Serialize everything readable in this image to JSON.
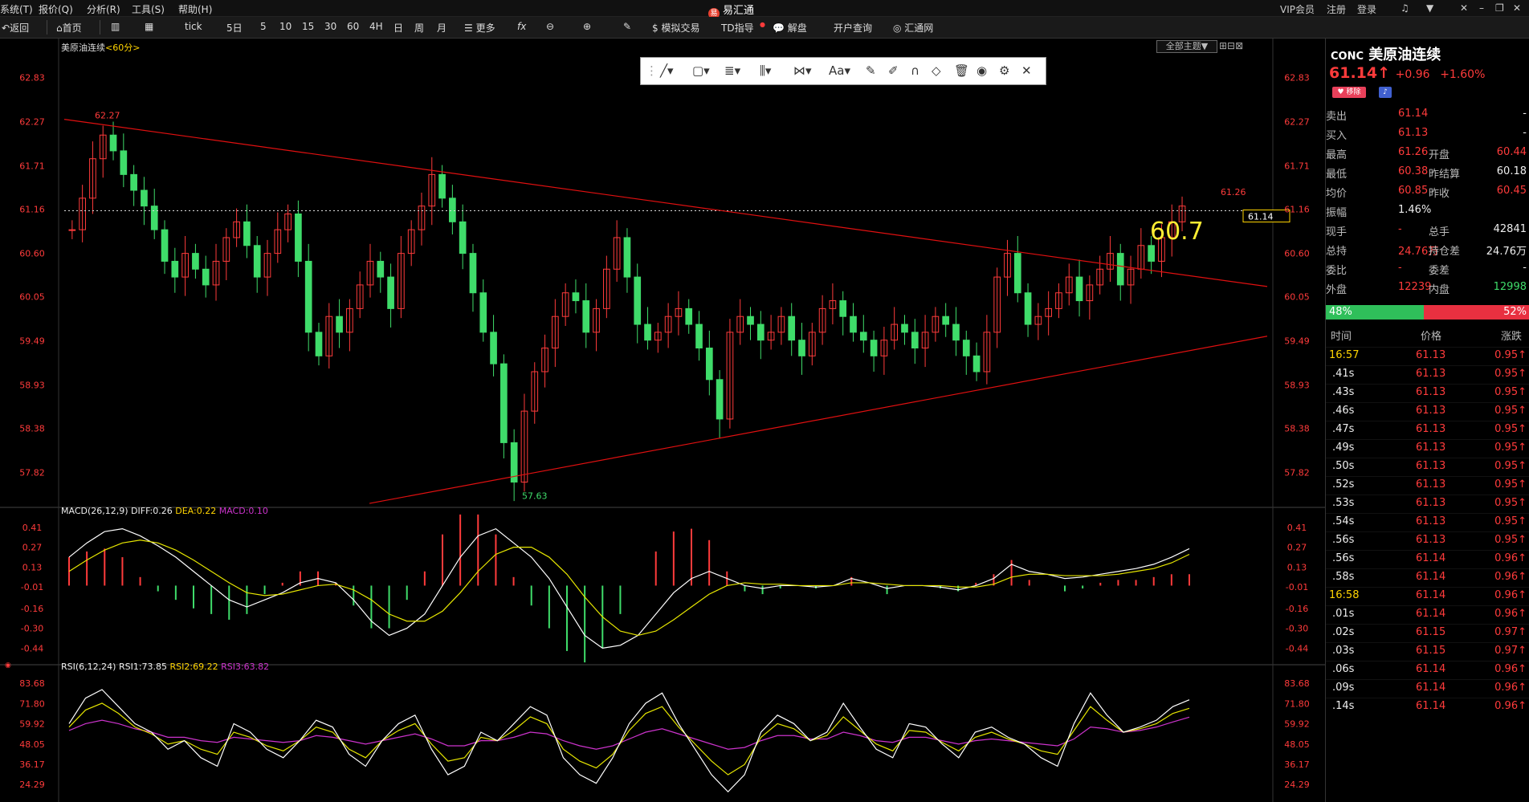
{
  "menu": {
    "items": [
      "系统(T)",
      "报价(Q)",
      "分析(R)",
      "工具(S)",
      "帮助(H)"
    ],
    "app_title": "易汇通",
    "right_items": [
      "VIP会员",
      "注册",
      "登录"
    ]
  },
  "toolbar": {
    "back": "返回",
    "home": "首页",
    "tick": "tick",
    "periods": [
      "5日",
      "5",
      "10",
      "15",
      "30",
      "60",
      "4H",
      "日",
      "周",
      "月"
    ],
    "more": "更多",
    "fx": "fx",
    "sim_trade": "模拟交易",
    "td_guide": "TD指导",
    "analysis": "解盘",
    "account_query": "开户查询",
    "huitong": "汇通网"
  },
  "chart": {
    "symbol_label": "美原油连续",
    "period_label": "<60分>",
    "theme_button": "全部主题",
    "price_ticks": [
      "62.83",
      "62.27",
      "61.71",
      "61.16",
      "60.60",
      "60.05",
      "59.49",
      "58.93",
      "58.38",
      "57.82"
    ],
    "current_price_tag": "61.14",
    "annot_high": "62.27",
    "annot_low": "57.63",
    "annot_recent_high": "61.26",
    "annot_big": "60.7",
    "macd": {
      "title": "MACD(26,12,9)",
      "diff": "DIFF:0.26",
      "dea": "DEA:0.22",
      "macd": "MACD:0.10",
      "ticks": [
        "0.41",
        "0.27",
        "0.13",
        "-0.01",
        "-0.16",
        "-0.30",
        "-0.44"
      ]
    },
    "rsi": {
      "title": "RSI(6,12,24)",
      "rsi1": "RSI1:73.85",
      "rsi2": "RSI2:69.22",
      "rsi3": "RSI3:63.82",
      "ticks": [
        "83.68",
        "71.80",
        "59.92",
        "48.05",
        "36.17",
        "24.29"
      ]
    },
    "colors": {
      "up": "#ff3b3b",
      "down": "#3fdc6a",
      "trend": "#e01010",
      "diff": "#ffffff",
      "dea": "#e6e600",
      "macd": "#cc33cc"
    }
  },
  "chart_data": {
    "type": "candlestick",
    "timeframe": "60分",
    "ylim": [
      57.4,
      63.1
    ],
    "price_close_series": [
      60.9,
      61.3,
      61.8,
      62.1,
      61.9,
      61.6,
      61.4,
      61.2,
      60.9,
      60.5,
      60.3,
      60.6,
      60.4,
      60.2,
      60.5,
      60.8,
      61.0,
      60.7,
      60.3,
      60.6,
      60.9,
      61.1,
      60.5,
      59.6,
      59.3,
      59.8,
      59.6,
      59.9,
      60.2,
      60.5,
      60.3,
      59.9,
      60.6,
      60.9,
      61.2,
      61.6,
      61.3,
      61.0,
      60.6,
      60.1,
      59.6,
      59.2,
      58.2,
      57.7,
      58.6,
      59.1,
      59.4,
      59.8,
      60.1,
      60.0,
      59.6,
      59.9,
      60.4,
      60.8,
      60.3,
      59.7,
      59.5,
      59.6,
      59.8,
      59.9,
      59.7,
      59.4,
      59.0,
      58.5,
      59.6,
      59.8,
      59.7,
      59.5,
      59.6,
      59.8,
      59.5,
      59.3,
      59.6,
      59.9,
      60.0,
      59.8,
      59.6,
      59.5,
      59.3,
      59.5,
      59.7,
      59.6,
      59.4,
      59.6,
      59.8,
      59.7,
      59.5,
      59.3,
      59.1,
      59.6,
      60.3,
      60.6,
      60.1,
      59.7,
      59.8,
      59.9,
      60.1,
      60.3,
      60.0,
      60.2,
      60.4,
      60.6,
      60.2,
      60.4,
      60.7,
      60.5,
      60.8,
      61.0,
      61.2
    ],
    "annotations": [
      "62.27",
      "57.63",
      "61.26",
      "60.7"
    ],
    "macd_series": {
      "diff": [
        0.2,
        0.3,
        0.38,
        0.4,
        0.35,
        0.28,
        0.2,
        0.1,
        0.0,
        -0.1,
        -0.15,
        -0.1,
        -0.05,
        0.02,
        0.05,
        0.02,
        -0.1,
        -0.25,
        -0.35,
        -0.3,
        -0.2,
        0.0,
        0.2,
        0.35,
        0.4,
        0.3,
        0.2,
        0.05,
        -0.15,
        -0.35,
        -0.44,
        -0.42,
        -0.35,
        -0.2,
        -0.05,
        0.05,
        0.1,
        0.05,
        0.0,
        -0.02,
        0.0,
        0.0,
        -0.01,
        0.0,
        0.05,
        0.02,
        -0.02,
        0.0,
        0.0,
        -0.01,
        -0.03,
        0.0,
        0.05,
        0.15,
        0.1,
        0.08,
        0.05,
        0.06,
        0.08,
        0.1,
        0.12,
        0.15,
        0.2,
        0.26
      ],
      "dea": [
        0.1,
        0.18,
        0.25,
        0.3,
        0.32,
        0.3,
        0.25,
        0.18,
        0.1,
        0.02,
        -0.05,
        -0.07,
        -0.06,
        -0.03,
        0.0,
        0.01,
        -0.03,
        -0.1,
        -0.2,
        -0.25,
        -0.25,
        -0.18,
        -0.05,
        0.1,
        0.22,
        0.27,
        0.27,
        0.2,
        0.08,
        -0.08,
        -0.22,
        -0.32,
        -0.35,
        -0.32,
        -0.24,
        -0.15,
        -0.06,
        0.0,
        0.02,
        0.01,
        0.01,
        0.0,
        0.0,
        0.0,
        0.02,
        0.02,
        0.01,
        0.0,
        0.0,
        0.0,
        -0.01,
        -0.01,
        0.01,
        0.06,
        0.08,
        0.08,
        0.07,
        0.07,
        0.07,
        0.08,
        0.1,
        0.12,
        0.16,
        0.22
      ]
    },
    "rsi_series": {
      "rsi1": [
        60,
        75,
        80,
        70,
        60,
        55,
        45,
        50,
        40,
        35,
        60,
        55,
        45,
        40,
        50,
        62,
        58,
        42,
        35,
        50,
        60,
        65,
        45,
        30,
        35,
        55,
        50,
        60,
        70,
        65,
        40,
        30,
        25,
        40,
        60,
        72,
        78,
        60,
        45,
        30,
        20,
        30,
        55,
        65,
        60,
        50,
        55,
        72,
        58,
        45,
        40,
        60,
        58,
        48,
        40,
        55,
        58,
        52,
        48,
        40,
        35,
        60,
        78,
        65,
        55,
        58,
        62,
        70,
        74
      ],
      "rsi2": [
        58,
        68,
        72,
        66,
        58,
        54,
        48,
        50,
        45,
        42,
        55,
        52,
        47,
        44,
        50,
        58,
        55,
        45,
        40,
        50,
        56,
        60,
        48,
        38,
        40,
        52,
        50,
        56,
        64,
        60,
        45,
        38,
        34,
        42,
        56,
        66,
        70,
        58,
        48,
        38,
        30,
        36,
        52,
        60,
        57,
        50,
        53,
        64,
        56,
        48,
        44,
        56,
        55,
        49,
        44,
        52,
        55,
        51,
        48,
        44,
        42,
        56,
        70,
        62,
        55,
        57,
        60,
        66,
        69
      ],
      "rsi3": [
        56,
        60,
        62,
        60,
        57,
        55,
        52,
        52,
        50,
        49,
        52,
        51,
        50,
        49,
        50,
        53,
        52,
        50,
        48,
        50,
        52,
        54,
        51,
        47,
        47,
        50,
        50,
        52,
        55,
        54,
        50,
        47,
        45,
        47,
        51,
        55,
        57,
        54,
        51,
        48,
        45,
        46,
        50,
        53,
        53,
        51,
        51,
        55,
        53,
        50,
        49,
        52,
        52,
        50,
        48,
        50,
        51,
        50,
        49,
        48,
        47,
        51,
        58,
        57,
        55,
        56,
        58,
        61,
        63.82
      ]
    }
  },
  "panel": {
    "code": "CONC",
    "name": "美原油连续",
    "price": "61.14",
    "arrow": "↑",
    "change": "+0.96",
    "change_pct": "+1.60%",
    "remove_label": "移除",
    "rows": [
      {
        "l1": "卖出",
        "v1": "61.14",
        "l2": "",
        "v2": "-"
      },
      {
        "l1": "买入",
        "v1": "61.13",
        "l2": "",
        "v2": "-"
      },
      {
        "l1": "最高",
        "v1": "61.26",
        "l2": "开盘",
        "v2": "60.44"
      },
      {
        "l1": "最低",
        "v1": "60.38",
        "l2": "昨结算",
        "v2": "60.18"
      },
      {
        "l1": "均价",
        "v1": "60.85",
        "l2": "昨收",
        "v2": "60.45"
      },
      {
        "l1": "振幅",
        "v1": "1.46%",
        "l2": "",
        "v2": ""
      },
      {
        "l1": "现手",
        "v1": "-",
        "l2": "总手",
        "v2": "42841"
      },
      {
        "l1": "总持",
        "v1": "24.76万",
        "l2": "持仓差",
        "v2": "24.76万"
      },
      {
        "l1": "委比",
        "v1": "-",
        "l2": "委差",
        "v2": "-"
      },
      {
        "l1": "外盘",
        "v1": "12239",
        "l2": "内盘",
        "v2": "12998"
      }
    ],
    "buy_ratio": "48%",
    "sell_ratio": "52%",
    "buy_fraction": 0.48,
    "tick_headers": [
      "时间",
      "价格",
      "涨跌"
    ],
    "ticks": [
      {
        "t": "16:57",
        "p": "61.13",
        "c": "0.95"
      },
      {
        "t": ".41s",
        "p": "61.13",
        "c": "0.95"
      },
      {
        "t": ".43s",
        "p": "61.13",
        "c": "0.95"
      },
      {
        "t": ".46s",
        "p": "61.13",
        "c": "0.95"
      },
      {
        "t": ".47s",
        "p": "61.13",
        "c": "0.95"
      },
      {
        "t": ".49s",
        "p": "61.13",
        "c": "0.95"
      },
      {
        "t": ".50s",
        "p": "61.13",
        "c": "0.95"
      },
      {
        "t": ".52s",
        "p": "61.13",
        "c": "0.95"
      },
      {
        "t": ".53s",
        "p": "61.13",
        "c": "0.95"
      },
      {
        "t": ".54s",
        "p": "61.13",
        "c": "0.95"
      },
      {
        "t": ".56s",
        "p": "61.13",
        "c": "0.95"
      },
      {
        "t": ".56s",
        "p": "61.14",
        "c": "0.96"
      },
      {
        "t": ".58s",
        "p": "61.14",
        "c": "0.96"
      },
      {
        "t": "16:58",
        "p": "61.14",
        "c": "0.96"
      },
      {
        "t": ".01s",
        "p": "61.14",
        "c": "0.96"
      },
      {
        "t": ".02s",
        "p": "61.15",
        "c": "0.97"
      },
      {
        "t": ".03s",
        "p": "61.15",
        "c": "0.97"
      },
      {
        "t": ".06s",
        "p": "61.14",
        "c": "0.96"
      },
      {
        "t": ".09s",
        "p": "61.14",
        "c": "0.96"
      },
      {
        "t": ".14s",
        "p": "61.14",
        "c": "0.96"
      }
    ]
  }
}
